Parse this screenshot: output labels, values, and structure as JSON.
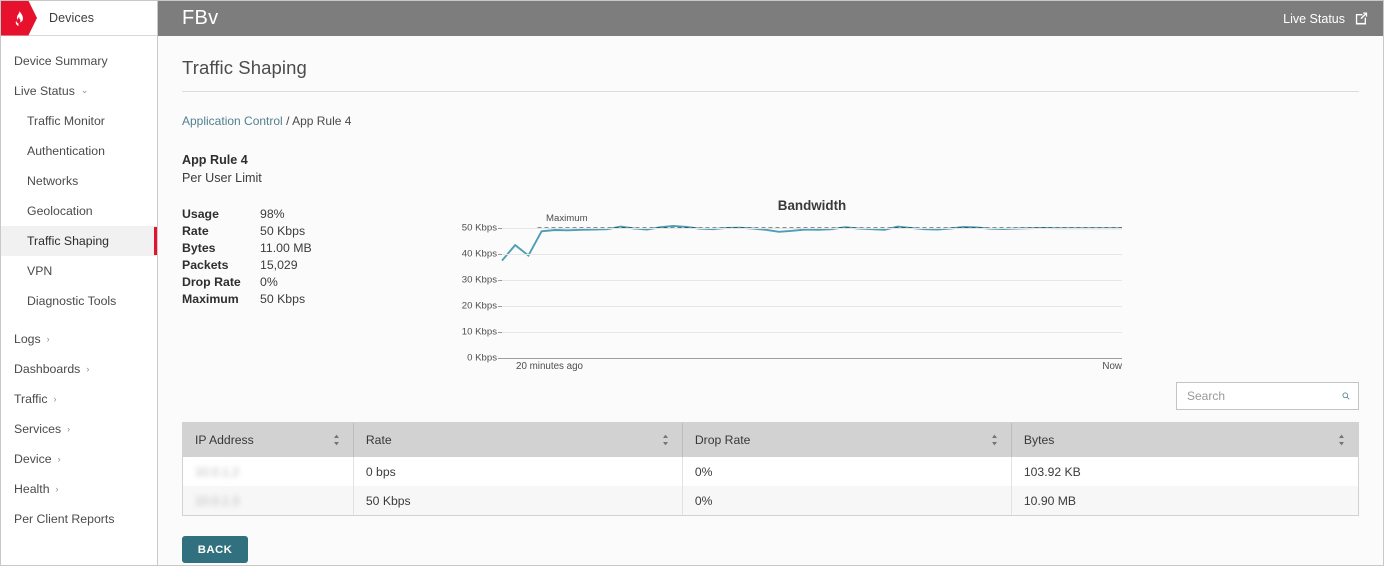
{
  "brand": {
    "label": "Devices",
    "logo_icon": "flame-icon",
    "logo_color": "#e8112d"
  },
  "topbar": {
    "app_title": "FBv",
    "live_status_label": "Live Status",
    "external_link_icon": "external-link-icon"
  },
  "sidebar": {
    "items": [
      {
        "label": "Device Summary",
        "level": "top",
        "selected": false,
        "chevron": ""
      },
      {
        "label": "Live Status",
        "level": "top",
        "selected": false,
        "chevron": "down"
      },
      {
        "label": "Traffic Monitor",
        "level": "sub",
        "selected": false,
        "chevron": ""
      },
      {
        "label": "Authentication",
        "level": "sub",
        "selected": false,
        "chevron": ""
      },
      {
        "label": "Networks",
        "level": "sub",
        "selected": false,
        "chevron": ""
      },
      {
        "label": "Geolocation",
        "level": "sub",
        "selected": false,
        "chevron": ""
      },
      {
        "label": "Traffic Shaping",
        "level": "sub",
        "selected": true,
        "chevron": ""
      },
      {
        "label": "VPN",
        "level": "sub",
        "selected": false,
        "chevron": ""
      },
      {
        "label": "Diagnostic Tools",
        "level": "sub",
        "selected": false,
        "chevron": ""
      },
      {
        "label": "Logs",
        "level": "top",
        "selected": false,
        "chevron": "right"
      },
      {
        "label": "Dashboards",
        "level": "top",
        "selected": false,
        "chevron": "right"
      },
      {
        "label": "Traffic",
        "level": "top",
        "selected": false,
        "chevron": "right"
      },
      {
        "label": "Services",
        "level": "top",
        "selected": false,
        "chevron": "right"
      },
      {
        "label": "Device",
        "level": "top",
        "selected": false,
        "chevron": "right"
      },
      {
        "label": "Health",
        "level": "top",
        "selected": false,
        "chevron": "right"
      },
      {
        "label": "Per Client Reports",
        "level": "top",
        "selected": false,
        "chevron": ""
      }
    ]
  },
  "main": {
    "page_title": "Traffic Shaping",
    "breadcrumb": {
      "link": "Application Control",
      "separator": " / ",
      "current": "App Rule 4"
    },
    "rule": {
      "name": "App Rule 4",
      "subtitle": "Per User Limit"
    },
    "stats": [
      {
        "key": "Usage",
        "value": "98%"
      },
      {
        "key": "Rate",
        "value": "50 Kbps"
      },
      {
        "key": "Bytes",
        "value": "11.00 MB"
      },
      {
        "key": "Packets",
        "value": "15,029"
      },
      {
        "key": "Drop Rate",
        "value": "0%"
      },
      {
        "key": "Maximum",
        "value": "50 Kbps"
      }
    ],
    "search": {
      "placeholder": "Search",
      "value": "",
      "icon": "search-icon"
    },
    "table": {
      "columns": [
        "IP Address",
        "Rate",
        "Drop Rate",
        "Bytes"
      ],
      "rows": [
        {
          "ip": "10.0.1.2",
          "ip_redacted": true,
          "rate": "0 bps",
          "drop_rate": "0%",
          "bytes": "103.92 KB"
        },
        {
          "ip": "10.0.1.3",
          "ip_redacted": true,
          "rate": "50 Kbps",
          "drop_rate": "0%",
          "bytes": "10.90 MB"
        }
      ]
    },
    "back_button": "BACK"
  },
  "chart_data": {
    "type": "line",
    "title": "Bandwidth",
    "xlabel": "",
    "ylabel": "",
    "ylim": [
      0,
      52
    ],
    "ytick_labels": [
      "50 Kbps",
      "40 Kbps",
      "30 Kbps",
      "20 Kbps",
      "10 Kbps",
      "0 Kbps"
    ],
    "ytick_values": [
      50,
      40,
      30,
      20,
      10,
      0
    ],
    "xtick_labels": [
      "20 minutes ago",
      "Now"
    ],
    "grid": true,
    "legend_position": "none",
    "annotations": [
      {
        "text": "Maximum",
        "value": 50,
        "style": "dashed-black-line"
      }
    ],
    "series": [
      {
        "name": "Bandwidth",
        "color": "#4e9fb5",
        "values": [
          37.5,
          43.5,
          39.5,
          48.8,
          49.3,
          49.2,
          49.4,
          49.5,
          49.6,
          50.6,
          49.9,
          49.5,
          50.4,
          50.9,
          50.5,
          49.8,
          49.6,
          50.1,
          50.2,
          49.9,
          49.4,
          48.6,
          49.0,
          49.5,
          49.4,
          49.6,
          50.4,
          49.9,
          49.6,
          49.4,
          50.6,
          50.1,
          49.6,
          49.5,
          49.9,
          50.5,
          50.3,
          49.8,
          49.7,
          49.9,
          50.0,
          50.1,
          50.0,
          50.0,
          50.0,
          50.0,
          50.0,
          50.0
        ]
      }
    ],
    "maximum_line": {
      "value": 50,
      "label": "Maximum",
      "color": "#1c1c1c"
    }
  }
}
